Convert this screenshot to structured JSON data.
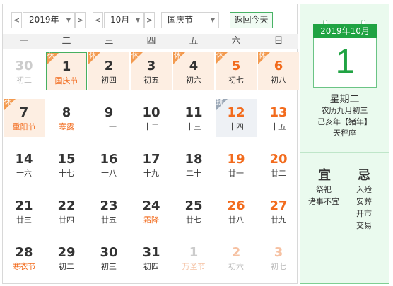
{
  "toolbar": {
    "prev_arrow": "<",
    "next_arrow": ">",
    "year_value": "2019年",
    "month_value": "10月",
    "holiday_value": "国庆节",
    "today_button": "返回今天"
  },
  "weekdays": [
    "一",
    "二",
    "三",
    "四",
    "五",
    "六",
    "日"
  ],
  "tags": {
    "rest": "休",
    "work": "班"
  },
  "weeks": [
    [
      {
        "d": "30",
        "l": "初二",
        "other": true
      },
      {
        "d": "1",
        "l": "国庆节",
        "festival": true,
        "tag": "rest",
        "selected": true
      },
      {
        "d": "2",
        "l": "初四",
        "tag": "rest"
      },
      {
        "d": "3",
        "l": "初五",
        "tag": "rest"
      },
      {
        "d": "4",
        "l": "初六",
        "tag": "rest"
      },
      {
        "d": "5",
        "l": "初七",
        "tag": "rest",
        "weekend": true
      },
      {
        "d": "6",
        "l": "初八",
        "tag": "rest",
        "weekend": true
      }
    ],
    [
      {
        "d": "7",
        "l": "重阳节",
        "tag": "rest",
        "festival": true
      },
      {
        "d": "8",
        "l": "寒露",
        "festival": true
      },
      {
        "d": "9",
        "l": "十一"
      },
      {
        "d": "10",
        "l": "十二"
      },
      {
        "d": "11",
        "l": "十三"
      },
      {
        "d": "12",
        "l": "十四",
        "tag": "work",
        "weekend": true
      },
      {
        "d": "13",
        "l": "十五",
        "weekend": true
      }
    ],
    [
      {
        "d": "14",
        "l": "十六"
      },
      {
        "d": "15",
        "l": "十七"
      },
      {
        "d": "16",
        "l": "十八"
      },
      {
        "d": "17",
        "l": "十九"
      },
      {
        "d": "18",
        "l": "二十"
      },
      {
        "d": "19",
        "l": "廿一",
        "weekend": true
      },
      {
        "d": "20",
        "l": "廿二",
        "weekend": true
      }
    ],
    [
      {
        "d": "21",
        "l": "廿三"
      },
      {
        "d": "22",
        "l": "廿四"
      },
      {
        "d": "23",
        "l": "廿五"
      },
      {
        "d": "24",
        "l": "霜降",
        "festival": true
      },
      {
        "d": "25",
        "l": "廿七"
      },
      {
        "d": "26",
        "l": "廿八",
        "weekend": true
      },
      {
        "d": "27",
        "l": "廿九",
        "weekend": true
      }
    ],
    [
      {
        "d": "28",
        "l": "寒衣节",
        "festival": true
      },
      {
        "d": "29",
        "l": "初二"
      },
      {
        "d": "30",
        "l": "初三"
      },
      {
        "d": "31",
        "l": "初四"
      },
      {
        "d": "1",
        "l": "万圣节",
        "other": true,
        "festival": true
      },
      {
        "d": "2",
        "l": "初六",
        "other": true,
        "weekend": true
      },
      {
        "d": "3",
        "l": "初七",
        "other": true,
        "weekend": true
      }
    ]
  ],
  "detail": {
    "card_header": "2019年10月",
    "big_day": "1",
    "weekday": "星期二",
    "lunar_date": "农历九月初三",
    "ganzhi": "己亥年【猪年】",
    "zodiac_sign": "天秤座",
    "yi_label": "宜",
    "ji_label": "忌",
    "yi_items": [
      "祭祀",
      "诸事不宜"
    ],
    "ji_items": [
      "入殓",
      "安葬",
      "开市",
      "交易"
    ]
  },
  "colors": {
    "accent_green": "#20a343",
    "holiday_orange": "#f26b1d",
    "rest_tag": "#f39a4f",
    "work_tag": "#9aa7b6"
  }
}
